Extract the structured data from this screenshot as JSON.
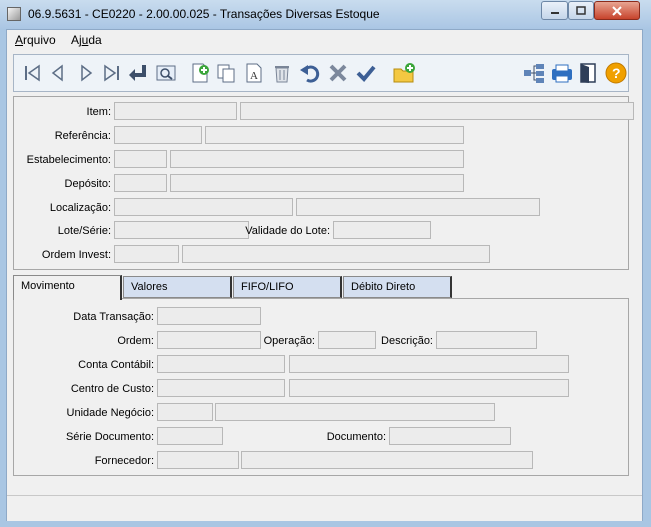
{
  "window": {
    "title": "06.9.5631 - CE0220 - 2.00.00.025 - Transações Diversas Estoque"
  },
  "menu": {
    "arquivo": {
      "label": "Arquivo",
      "mnemonic": "A",
      "rest": "rquivo"
    },
    "ajuda": {
      "label": "Ajuda",
      "prefix": "Aj",
      "mnemonic": "u",
      "rest": "da"
    }
  },
  "toolbar": {
    "buttons": [
      "first",
      "previous",
      "next",
      "last",
      "go-to",
      "query",
      "add",
      "copy",
      "edit",
      "delete",
      "undo",
      "cancel",
      "save",
      "new-folder",
      "navigation",
      "print",
      "exit",
      "help"
    ]
  },
  "header_form": {
    "item": {
      "label": "Item:"
    },
    "referencia": {
      "label": "Referência:"
    },
    "estabelecimento": {
      "label": "Estabelecimento:"
    },
    "deposito": {
      "label": "Depósito:"
    },
    "localizacao": {
      "label": "Localização:"
    },
    "lote_serie": {
      "label": "Lote/Série:"
    },
    "validade_lote": {
      "label": "Validade do Lote:"
    },
    "ordem_invest": {
      "label": "Ordem Invest:"
    }
  },
  "tabs": [
    {
      "label": "Movimento",
      "active": true
    },
    {
      "label": "Valores",
      "active": false
    },
    {
      "label": "FIFO/LIFO",
      "active": false
    },
    {
      "label": "Débito Direto",
      "active": false
    }
  ],
  "movimento": {
    "data_transacao": {
      "label": "Data Transação:"
    },
    "ordem": {
      "label": "Ordem:"
    },
    "operacao": {
      "label": "Operação:"
    },
    "descricao": {
      "label": "Descrição:"
    },
    "conta_contabil": {
      "label": "Conta Contábil:"
    },
    "centro_custo": {
      "label": "Centro de Custo:"
    },
    "unidade_negocio": {
      "label": "Unidade Negócio:"
    },
    "serie_documento": {
      "label": "Série Documento:"
    },
    "documento": {
      "label": "Documento:"
    },
    "fornecedor": {
      "label": "Fornecedor:"
    }
  },
  "colors": {
    "titlebar": "#aac6e4",
    "tab_inactive": "#d4dff0",
    "field_bg": "#ececec",
    "toolbar_icon": "#3a72b8",
    "help_icon": "#f0a000"
  }
}
